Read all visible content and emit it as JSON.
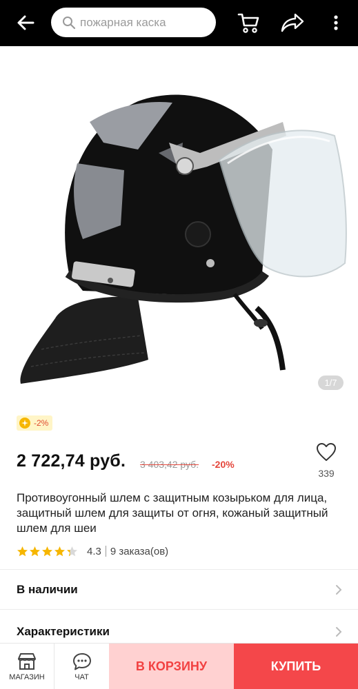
{
  "header": {
    "search_placeholder": "пожарная каска",
    "icons": [
      "back-arrow-icon",
      "search-icon",
      "cart-icon",
      "share-icon",
      "more-vertical-icon"
    ]
  },
  "gallery": {
    "counter": "1/7",
    "current_index": 1,
    "total": 7
  },
  "coupon": {
    "text": "-2%",
    "icon": "coupon-icon",
    "color": "#f6b600"
  },
  "price": {
    "current": "2 722,74 руб.",
    "old": "3 403,42 руб.",
    "discount": "-20%",
    "accent_color": "#e4463b"
  },
  "wishlist": {
    "count": "339",
    "icon": "heart-outline-icon"
  },
  "product": {
    "title": "Противоугонный шлем с защитным козырьком для лица, защитный шлем для защиты от огня, кожаный защитный шлем для шеи"
  },
  "rating": {
    "value": "4.3",
    "stars": 4.3,
    "orders": "9 заказа(ов)",
    "star_color": "#f6b600"
  },
  "rows": [
    {
      "label": "В наличии"
    },
    {
      "label": "Характеристики"
    }
  ],
  "bottom_bar": {
    "store_label": "МАГАЗИН",
    "chat_label": "ЧАТ",
    "add_to_cart": "В КОРЗИНУ",
    "buy": "КУПИТЬ",
    "cart_bg": "#ffd1d1",
    "buy_bg": "#f4474a"
  }
}
